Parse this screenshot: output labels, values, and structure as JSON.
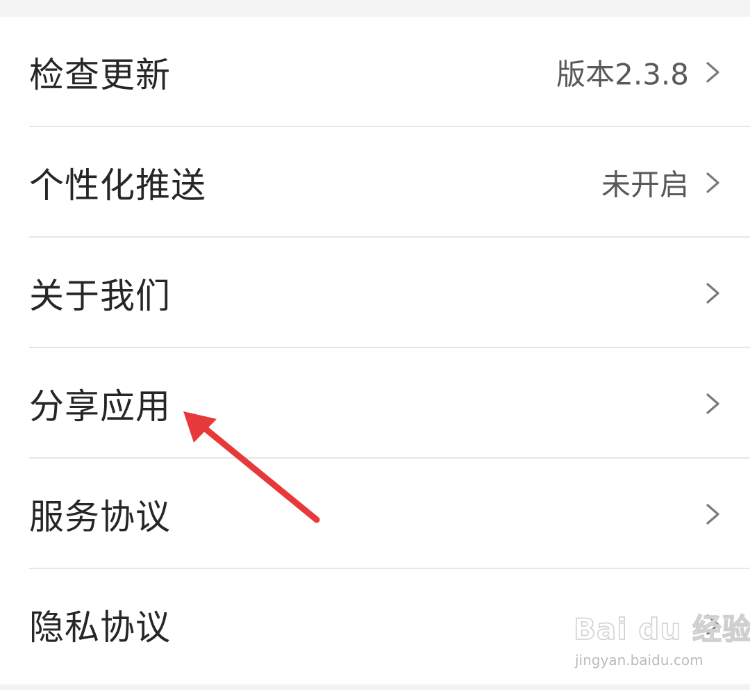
{
  "settings": {
    "items": [
      {
        "label": "检查更新",
        "value": "版本2.3.8",
        "chevron": "chevron-right-icon"
      },
      {
        "label": "个性化推送",
        "value": "未开启",
        "chevron": "chevron-right-icon"
      },
      {
        "label": "关于我们",
        "value": "",
        "chevron": "chevron-right-icon"
      },
      {
        "label": "分享应用",
        "value": "",
        "chevron": "chevron-right-icon"
      },
      {
        "label": "服务协议",
        "value": "",
        "chevron": "chevron-right-icon"
      },
      {
        "label": "隐私协议",
        "value": "",
        "chevron": "chevron-right-icon"
      }
    ]
  },
  "annotation": {
    "arrow_color": "#e8393a",
    "target": "分享应用"
  },
  "watermark": {
    "brand": "Bai du 经验",
    "url": "jingyan.baidu.com"
  },
  "colors": {
    "background": "#f3f3f3",
    "panel": "#ffffff",
    "text": "#262626",
    "secondary_text": "#595959",
    "divider": "#e6e6e6"
  }
}
